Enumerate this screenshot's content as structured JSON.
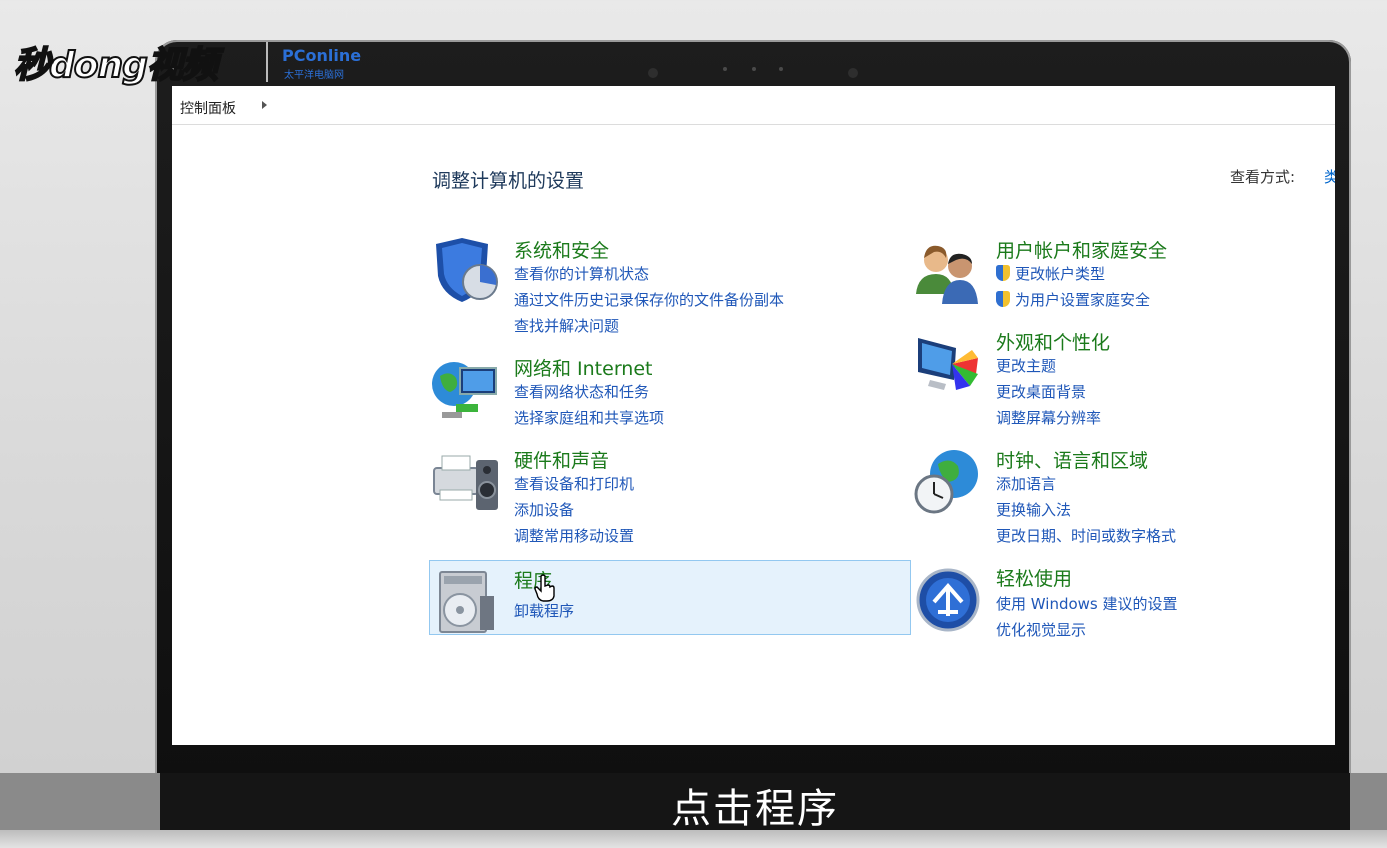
{
  "watermark": {
    "brand": "秒dong视频",
    "partner": "PConline",
    "partner_sub": "太平洋电脑网"
  },
  "breadcrumb": {
    "root": "控制面板"
  },
  "page": {
    "heading": "调整计算机的设置",
    "view_by_label": "查看方式:",
    "view_by_value": "类"
  },
  "categories": {
    "system": {
      "title": "系统和安全",
      "icon": "shield-icon",
      "links": [
        "查看你的计算机状态",
        "通过文件历史记录保存你的文件备份副本",
        "查找并解决问题"
      ]
    },
    "network": {
      "title": "网络和 Internet",
      "icon": "network-globe-icon",
      "links": [
        "查看网络状态和任务",
        "选择家庭组和共享选项"
      ]
    },
    "hardware": {
      "title": "硬件和声音",
      "icon": "printer-icon",
      "links": [
        "查看设备和打印机",
        "添加设备",
        "调整常用移动设置"
      ]
    },
    "programs": {
      "title": "程序",
      "icon": "programs-icon",
      "links": [
        "卸载程序"
      ]
    },
    "users": {
      "title": "用户帐户和家庭安全",
      "icon": "users-icon",
      "links": [
        "更改帐户类型",
        "为用户设置家庭安全"
      ]
    },
    "appearance": {
      "title": "外观和个性化",
      "icon": "monitor-palette-icon",
      "links": [
        "更改主题",
        "更改桌面背景",
        "调整屏幕分辨率"
      ]
    },
    "clock": {
      "title": "时钟、语言和区域",
      "icon": "clock-globe-icon",
      "links": [
        "添加语言",
        "更换输入法",
        "更改日期、时间或数字格式"
      ]
    },
    "ease": {
      "title": "轻松使用",
      "icon": "ease-of-access-icon",
      "links": [
        "使用 Windows 建议的设置",
        "优化视觉显示"
      ]
    }
  },
  "caption": "点击程序"
}
